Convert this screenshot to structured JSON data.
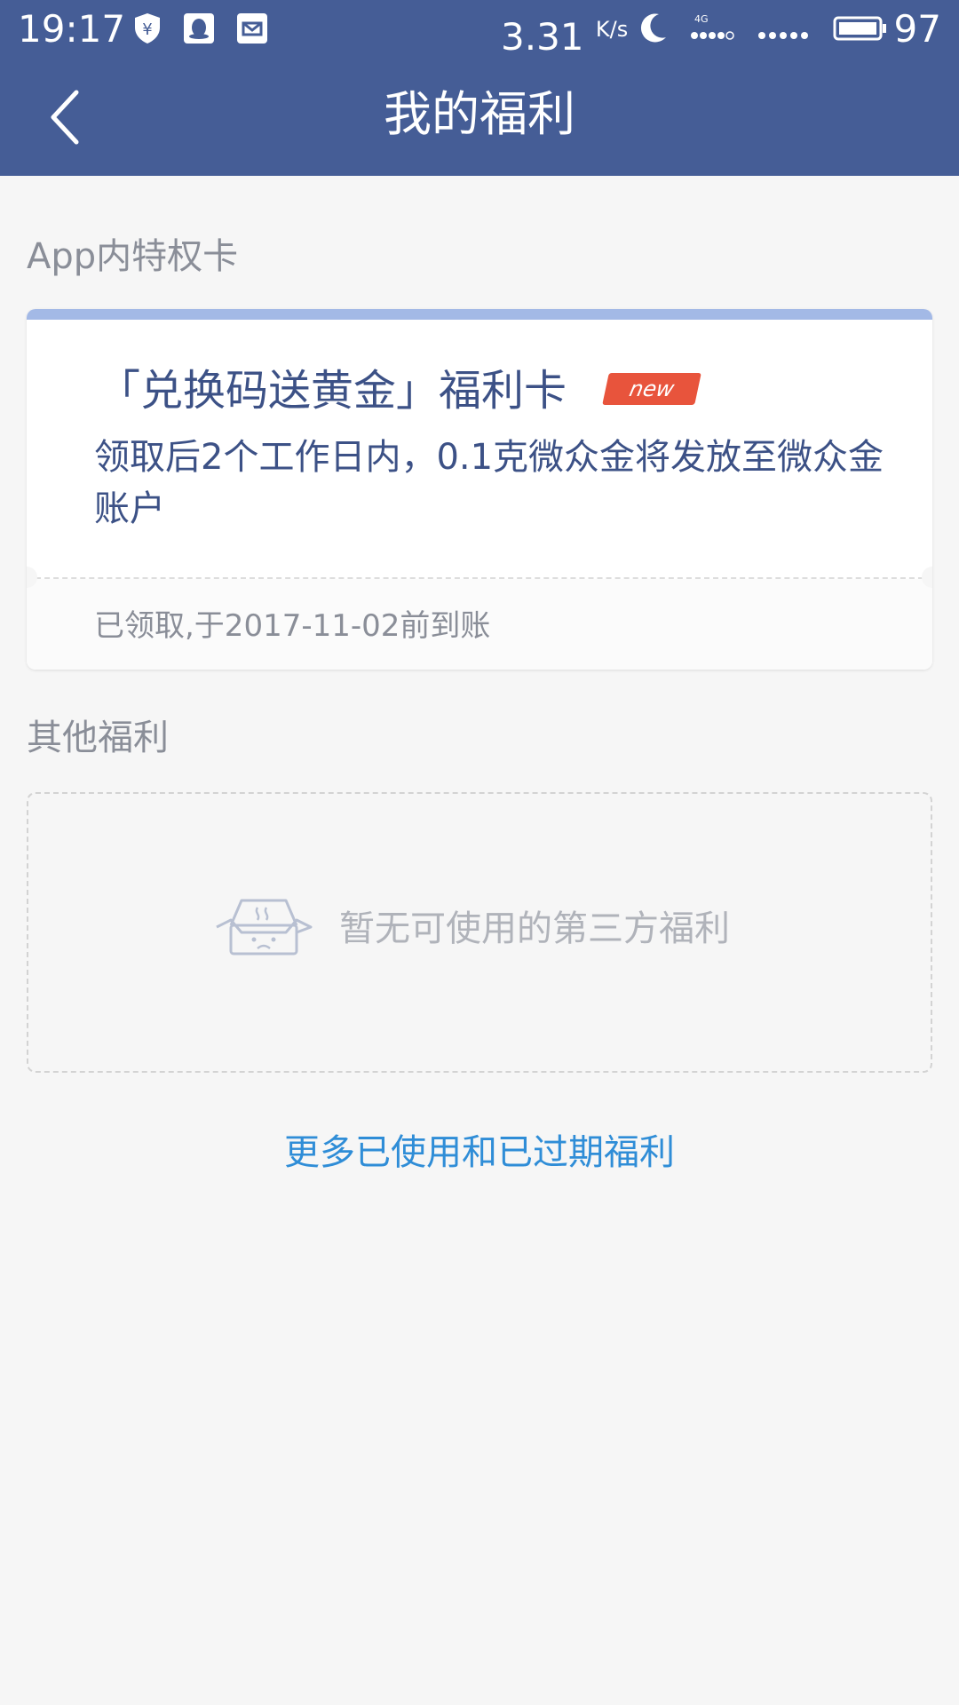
{
  "status_bar": {
    "time": "19:17",
    "net_speed": "3.31",
    "net_speed_unit": "K/s",
    "network": "4G",
    "battery": "97"
  },
  "header": {
    "title": "我的福利"
  },
  "sections": {
    "app_cards_title": "App内特权卡",
    "other_title": "其他福利"
  },
  "card": {
    "title": "「兑换码送黄金」福利卡",
    "badge": "new",
    "description": "领取后2个工作日内，0.1克微众金将发放至微众金账户",
    "status": "已领取,于2017-11-02前到账"
  },
  "empty_state": {
    "text": "暂无可使用的第三方福利"
  },
  "footer": {
    "more_link": "更多已使用和已过期福利"
  },
  "colors": {
    "header_bg": "#455d96",
    "card_accent": "#a3b9e6",
    "badge_bg": "#e8543c",
    "link": "#2f8dd7"
  }
}
